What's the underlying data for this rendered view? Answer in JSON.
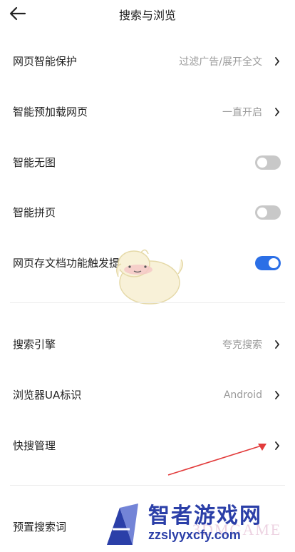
{
  "header": {
    "title": "搜索与浏览"
  },
  "settings": [
    {
      "label": "网页智能保护",
      "value": "过滤广告/展开全文"
    },
    {
      "label": "智能预加载网页",
      "value": "一直开启"
    },
    {
      "label": "智能无图",
      "toggle": false
    },
    {
      "label": "智能拼页",
      "toggle": false
    },
    {
      "label": "网页存文档功能触发提示",
      "toggle": true
    },
    {
      "label": "搜索引擎",
      "value": "夸克搜索"
    },
    {
      "label": "浏览器UA标识",
      "value": "Android"
    },
    {
      "label": "快搜管理"
    },
    {
      "label": "预置搜索词"
    }
  ],
  "watermark": {
    "brand": "智者游戏网",
    "url": "zzslyyxcfy.com",
    "faint": "3DMGAME"
  },
  "colors": {
    "toggle_on": "#2b6fe6",
    "toggle_off": "#c8c8c8",
    "value_text": "#9a9a9a",
    "arrow": "#e23b3b"
  }
}
